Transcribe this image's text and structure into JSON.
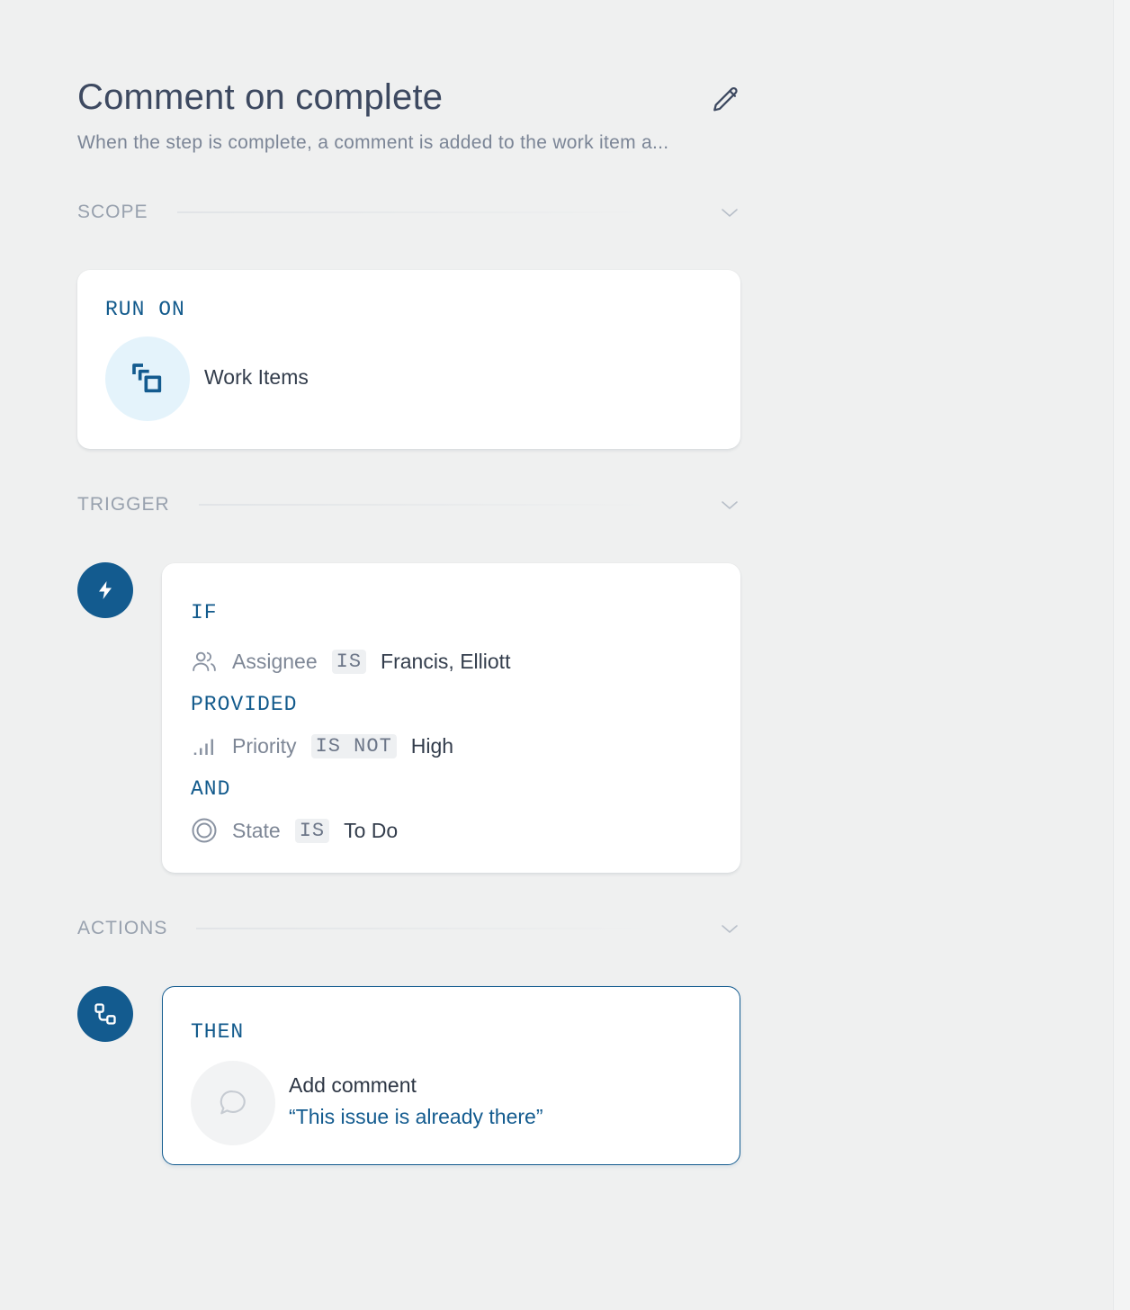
{
  "header": {
    "title": "Comment on complete",
    "description": "When the step is complete, a comment is added to the work item a..."
  },
  "scope": {
    "section_label": "SCOPE",
    "run_on_label": "RUN ON",
    "target": "Work Items"
  },
  "trigger": {
    "section_label": "TRIGGER",
    "if_label": "IF",
    "conditions": [
      {
        "field": "Assignee",
        "operator": "IS",
        "value": "Francis, Elliott",
        "icon": "users-icon"
      },
      {
        "connector": "PROVIDED",
        "field": "Priority",
        "operator": "IS NOT",
        "value": "High",
        "icon": "priority-bars-icon"
      },
      {
        "connector": "AND",
        "field": "State",
        "operator": "IS",
        "value": "To Do",
        "icon": "state-circle-icon"
      }
    ]
  },
  "actions": {
    "section_label": "ACTIONS",
    "then_label": "THEN",
    "action_title": "Add comment",
    "action_detail": "“This issue is already there”"
  },
  "colors": {
    "accent": "#135b8f",
    "keyword": "#125a8c",
    "background": "#eff0f0",
    "card": "#ffffff"
  }
}
